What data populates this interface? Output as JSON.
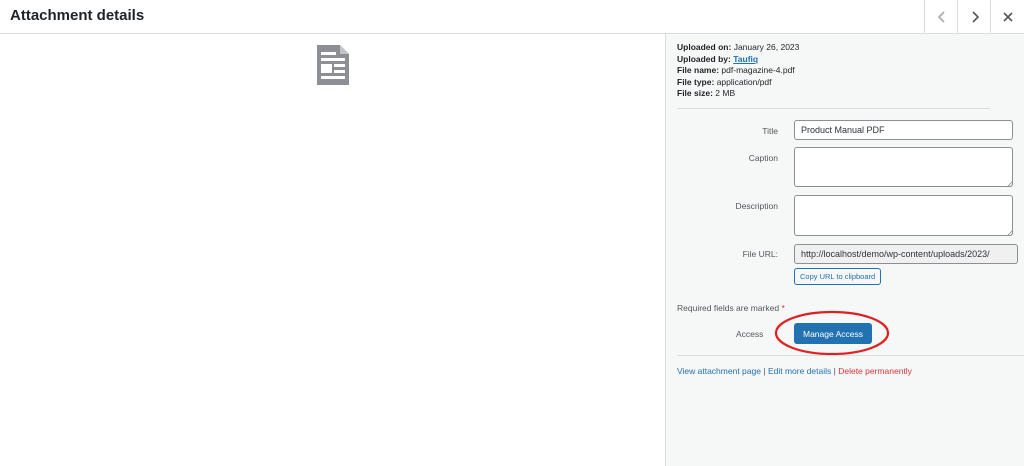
{
  "header": {
    "title": "Attachment details",
    "prev_icon": "chevron-left-icon",
    "next_icon": "chevron-right-icon",
    "close_icon": "close-icon"
  },
  "preview": {
    "icon": "document-icon"
  },
  "meta": {
    "uploaded_on_label": "Uploaded on:",
    "uploaded_on": "January 26, 2023",
    "uploaded_by_label": "Uploaded by:",
    "uploaded_by": "Taufiq",
    "file_name_label": "File name:",
    "file_name": "pdf-magazine-4.pdf",
    "file_type_label": "File type:",
    "file_type": "application/pdf",
    "file_size_label": "File size:",
    "file_size": "2 MB"
  },
  "form": {
    "title_label": "Title",
    "title_value": "Product Manual PDF",
    "caption_label": "Caption",
    "caption_value": "",
    "description_label": "Description",
    "description_value": "",
    "file_url_label": "File URL:",
    "file_url_value": "http://localhost/demo/wp-content/uploads/2023/",
    "copy_button": "Copy URL to clipboard",
    "required_text": "Required fields are marked",
    "required_star": "*",
    "access_label": "Access",
    "manage_access_button": "Manage Access"
  },
  "links": {
    "view": "View attachment page",
    "edit": "Edit more details",
    "delete": "Delete permanently",
    "separator": "|"
  },
  "colors": {
    "accent": "#2271b1",
    "danger": "#d63638",
    "highlight_ring": "#e02020"
  }
}
